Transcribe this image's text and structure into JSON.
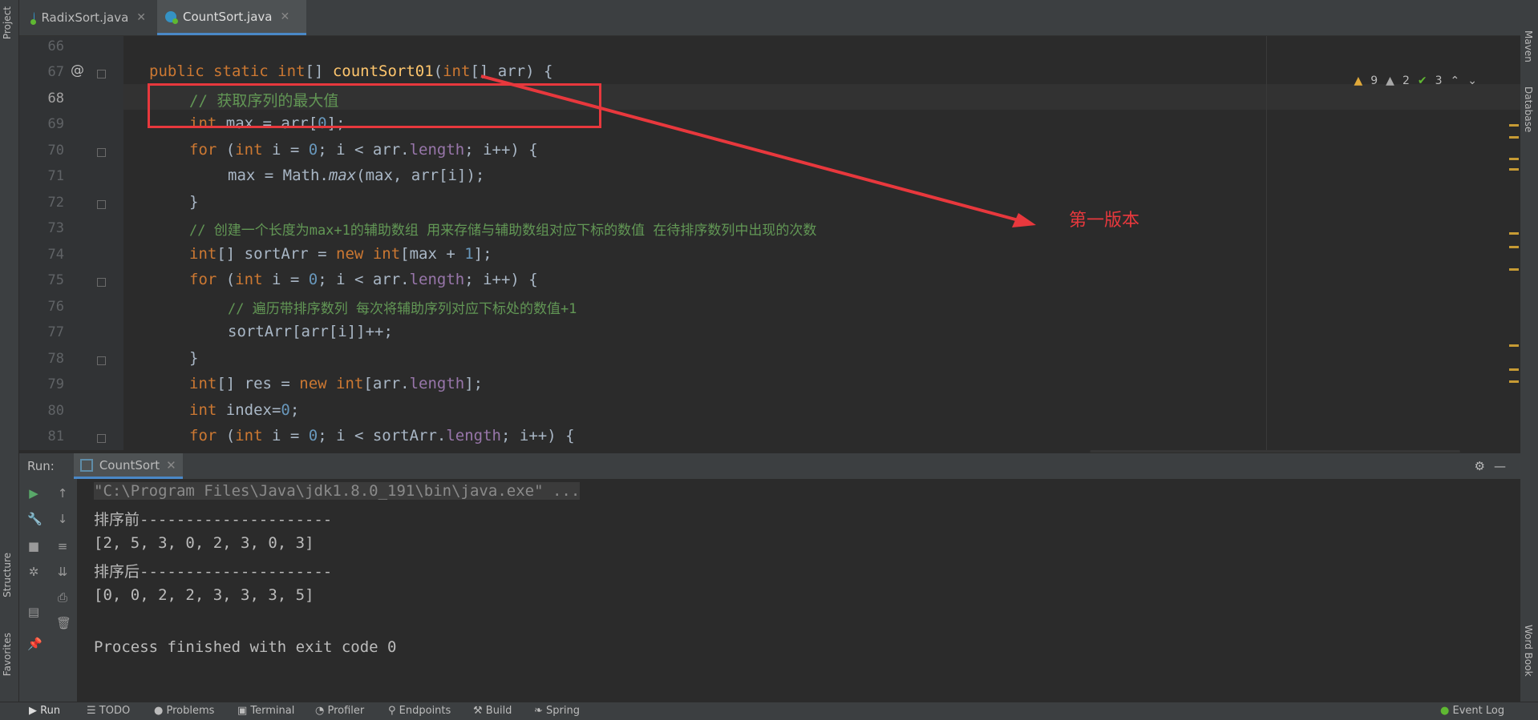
{
  "left_tools": [
    "Project",
    "Structure",
    "Favorites"
  ],
  "right_tools": [
    "Maven",
    "Database",
    "Word Book"
  ],
  "tabs": [
    {
      "label": "RadixSort.java",
      "active": false
    },
    {
      "label": "CountSort.java",
      "active": true
    }
  ],
  "inspections": {
    "warnings": "9",
    "weak_warnings": "2",
    "ok": "3"
  },
  "line_numbers": [
    "66",
    "67",
    "68",
    "69",
    "70",
    "71",
    "72",
    "73",
    "74",
    "75",
    "76",
    "77",
    "78",
    "79",
    "80",
    "81"
  ],
  "annotation": "第一版本",
  "code": {
    "l67": {
      "kw1": "public static ",
      "t1": "int",
      "p1": "[] ",
      "fn": "countSort01",
      "p2": "(",
      "t2": "int",
      "p3": "[] arr) {"
    },
    "l68": "// 获取序列的最大值",
    "l69": {
      "t": "int",
      "rest": " max = arr[",
      "n": "0",
      "end": "];"
    },
    "l70": {
      "for": "for",
      "a": " (",
      "t": "int",
      "b": " i = ",
      "n": "0",
      "c": "; i < arr.",
      "f": "length",
      "d": "; i++) {"
    },
    "l71": {
      "a": "max = Math.",
      "m": "max",
      "b": "(max, arr[i]);"
    },
    "l72": "}",
    "l73": "// 创建一个长度为max+1的辅助数组 用来存储与辅助数组对应下标的数值 在待排序数列中出现的次数",
    "l74": {
      "t": "int",
      "a": "[] sortArr = ",
      "nw": "new ",
      "t2": "int",
      "b": "[max + ",
      "n": "1",
      "c": "];"
    },
    "l75": {
      "for": "for",
      "a": " (",
      "t": "int",
      "b": " i = ",
      "n": "0",
      "c": "; i < arr.",
      "f": "length",
      "d": "; i++) {"
    },
    "l76": "// 遍历带排序数列 每次将辅助序列对应下标处的数值+1",
    "l77": "sortArr[arr[i]]++;",
    "l78": "}",
    "l79": {
      "t": "int",
      "a": "[] res = ",
      "nw": "new ",
      "t2": "int",
      "b": "[arr.",
      "f": "length",
      "c": "];"
    },
    "l80": {
      "t": "int",
      "a": " index=",
      "n": "0",
      "c": ";"
    },
    "l81": {
      "for": "for",
      "a": " (",
      "t": "int",
      "b": " i = ",
      "n": "0",
      "c": "; i < sortArr.",
      "f": "length",
      "d": "; i++) {"
    }
  },
  "run": {
    "label": "Run:",
    "config": "CountSort",
    "console": [
      "\"C:\\Program Files\\Java\\jdk1.8.0_191\\bin\\java.exe\" ...",
      "排序前---------------------",
      "[2, 5, 3, 0, 2, 3, 0, 3]",
      "排序后---------------------",
      "[0, 0, 2, 2, 3, 3, 3, 5]",
      "",
      "Process finished with exit code 0"
    ]
  },
  "bottom_tabs": [
    "Run",
    "TODO",
    "Problems",
    "Terminal",
    "Profiler",
    "Endpoints",
    "Build",
    "Spring"
  ],
  "event_log": "Event Log",
  "colors": {
    "accent": "#4a88c7",
    "annotation": "#e8383d",
    "comment": "#629755",
    "keyword": "#cc7832"
  }
}
